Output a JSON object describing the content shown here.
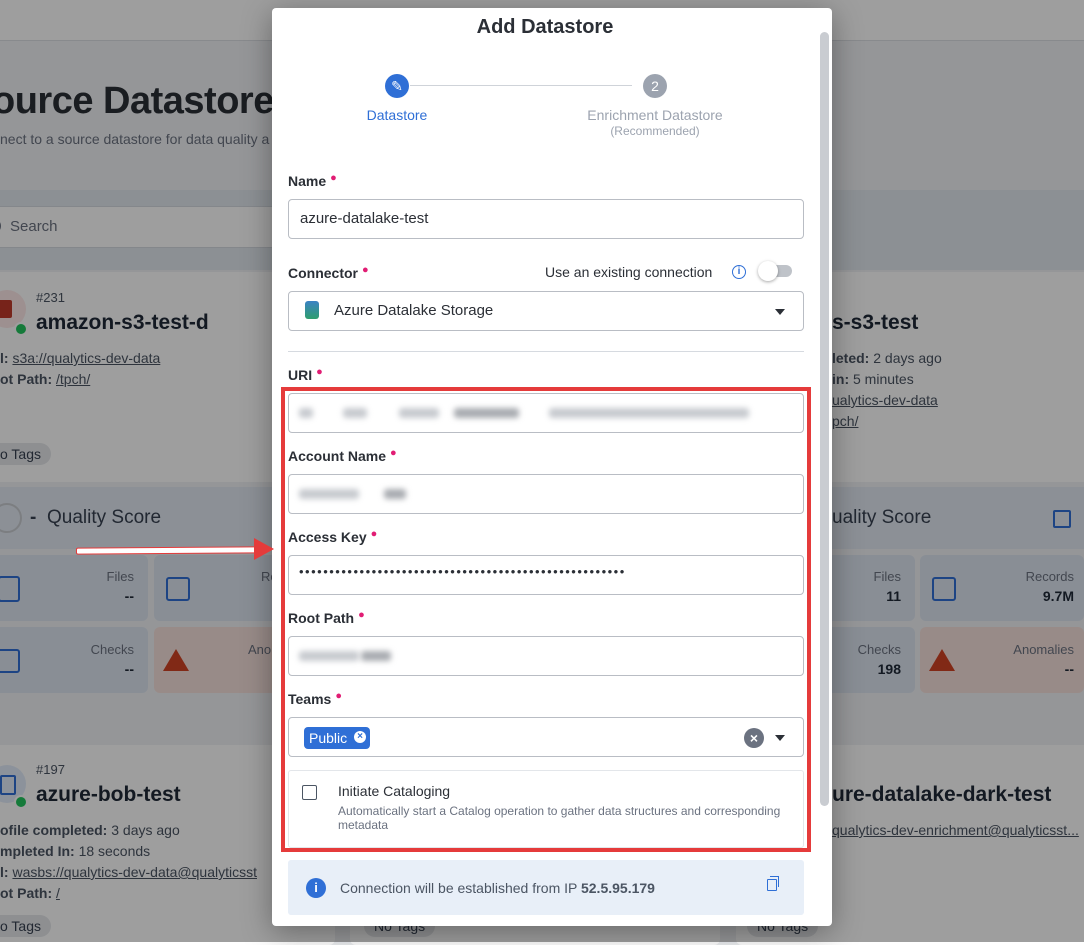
{
  "background": {
    "page_title": "ource Datastore",
    "page_subtitle": "nect to a source datastore for data quality a",
    "search_placeholder": "Search",
    "cards": [
      {
        "id": "#231",
        "name": "amazon-s3-test-d",
        "line1_label": "l:",
        "line1_value": "s3a://qualytics-dev-data",
        "line2_label": "ot Path:",
        "line2_value": "/tpch/",
        "tag": "o Tags",
        "score_dash": "-",
        "score_label": "Quality Score",
        "stats": [
          {
            "label": "Files",
            "value": "--"
          },
          {
            "label": "Re",
            "value": ""
          },
          {
            "label": "Checks",
            "value": "--"
          },
          {
            "label": "Ano",
            "value": ""
          }
        ]
      },
      {
        "id": "",
        "name": "s-s3-test",
        "line1_label": "leted:",
        "line1_value": "2 days ago",
        "line2_label": "in:",
        "line2_value": "5 minutes",
        "line3_value": "ualytics-dev-data",
        "line4_value": "pch/",
        "score_label": "uality Score",
        "stats": [
          {
            "label": "Files",
            "value": "11"
          },
          {
            "label": "Records",
            "value": "9.7M"
          },
          {
            "label": "Checks",
            "value": "198"
          },
          {
            "label": "Anomalies",
            "value": "--"
          }
        ]
      },
      {
        "id": "#197",
        "name": "azure-bob-test",
        "line1_label": "ofile completed:",
        "line1_value": "3 days ago",
        "line2_label": "mpleted In:",
        "line2_value": "18 seconds",
        "line3_label": "l:",
        "line3_value": "wasbs://qualytics-dev-data@qualyticsst",
        "line4_label": "ot Path:",
        "line4_value": "/",
        "tag": "o Tags"
      },
      {
        "id": "0",
        "name": "ure-datalake-dark-test",
        "line1_value": "qualytics-dev-enrichment@qualyticsst...",
        "tag": "No Tags"
      }
    ],
    "middle_tag": "No Tags"
  },
  "modal": {
    "title": "Add Datastore",
    "steps": [
      {
        "number": "✎",
        "label": "Datastore",
        "sub": ""
      },
      {
        "number": "2",
        "label": "Enrichment Datastore",
        "sub": "(Recommended)"
      }
    ],
    "name": {
      "label": "Name",
      "value": "azure-datalake-test"
    },
    "connector": {
      "label": "Connector",
      "value": "Azure Datalake Storage",
      "existing_label": "Use an existing connection"
    },
    "uri": {
      "label": "URI"
    },
    "account_name": {
      "label": "Account Name"
    },
    "access_key": {
      "label": "Access Key",
      "value": "••••••••••••••••••••••••••••••••••••••••••••••••••••••"
    },
    "root_path": {
      "label": "Root Path"
    },
    "teams": {
      "label": "Teams",
      "chip": "Public"
    },
    "cataloging": {
      "title": "Initiate Cataloging",
      "description": "Automatically start a Catalog operation to gather data structures and corresponding metadata"
    },
    "ip_notice": {
      "text": "Connection will be established from IP",
      "ip": "52.5.95.179"
    }
  },
  "colors": {
    "accent": "#2f6fd6",
    "required": "#e11d74",
    "highlight": "#e53b3b"
  }
}
